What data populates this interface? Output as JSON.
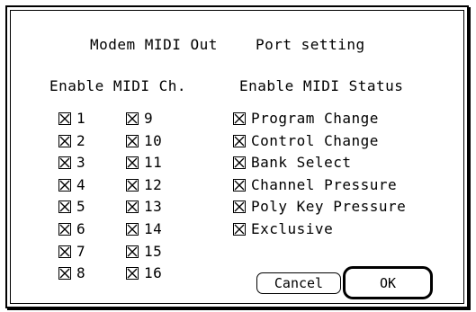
{
  "header": {
    "title_left": "Modem MIDI Out",
    "title_right": "Port setting"
  },
  "channels": {
    "heading": "Enable MIDI Ch.",
    "items": [
      {
        "label": "1",
        "checked": true
      },
      {
        "label": "2",
        "checked": true
      },
      {
        "label": "3",
        "checked": true
      },
      {
        "label": "4",
        "checked": true
      },
      {
        "label": "5",
        "checked": true
      },
      {
        "label": "6",
        "checked": true
      },
      {
        "label": "7",
        "checked": true
      },
      {
        "label": "8",
        "checked": true
      },
      {
        "label": "9",
        "checked": true
      },
      {
        "label": "10",
        "checked": true
      },
      {
        "label": "11",
        "checked": true
      },
      {
        "label": "12",
        "checked": true
      },
      {
        "label": "13",
        "checked": true
      },
      {
        "label": "14",
        "checked": true
      },
      {
        "label": "15",
        "checked": true
      },
      {
        "label": "16",
        "checked": true
      }
    ]
  },
  "status": {
    "heading": "Enable MIDI Status",
    "items": [
      {
        "label": "Program Change",
        "checked": true
      },
      {
        "label": "Control Change",
        "checked": true
      },
      {
        "label": "Bank Select",
        "checked": true
      },
      {
        "label": "Channel Pressure",
        "checked": true
      },
      {
        "label": "Poly Key Pressure",
        "checked": true
      },
      {
        "label": "Exclusive",
        "checked": true
      }
    ]
  },
  "buttons": {
    "cancel_label": "Cancel",
    "ok_label": "OK"
  }
}
